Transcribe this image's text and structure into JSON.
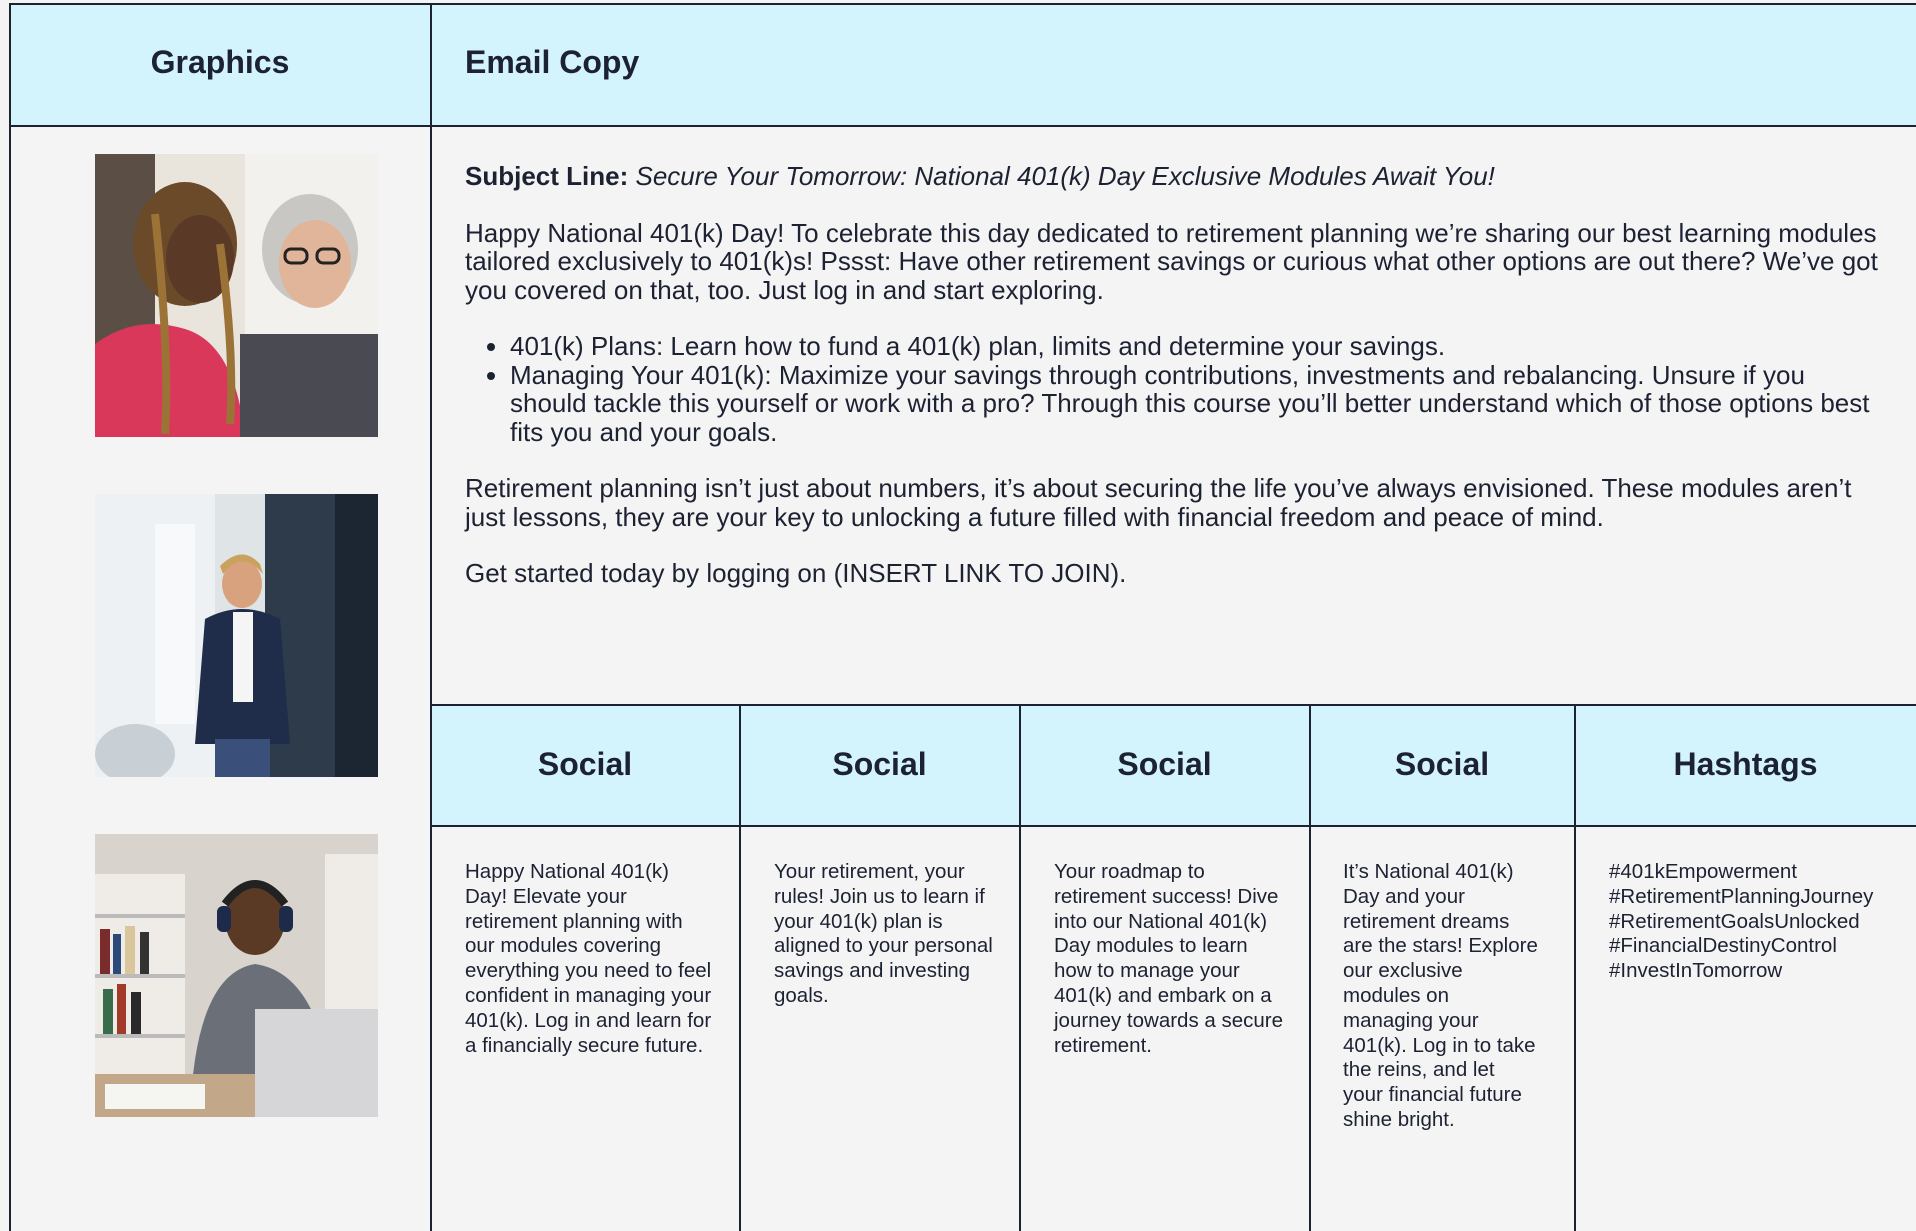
{
  "headers": {
    "graphics": "Graphics",
    "email_copy": "Email Copy"
  },
  "graphics": [
    {
      "name": "photo-two-women-laptop",
      "alt": "Two women looking at a laptop"
    },
    {
      "name": "photo-woman-presenting",
      "alt": "Smiling woman standing in an office"
    },
    {
      "name": "photo-man-headphones",
      "alt": "Man with headphones at a laptop"
    }
  ],
  "email": {
    "subject_label": "Subject Line:",
    "subject_text": "Secure Your Tomorrow: National 401(k) Day Exclusive Modules Await You!",
    "intro": "Happy National 401(k) Day!  To celebrate this day dedicated to retirement planning we’re sharing our best learning modules tailored exclusively to 401(k)s!  Pssst: Have other retirement savings or curious what other options are out there?  We’ve got you covered on that, too.  Just log in and start exploring.",
    "bullets": [
      "401(k) Plans: Learn how to fund a 401(k) plan, limits and determine your savings.",
      "Managing Your 401(k): Maximize your savings through contributions, investments and rebalancing.  Unsure if you should tackle this yourself or work with a pro? Through this course you’ll better understand which of those options best fits you and your goals."
    ],
    "body": "Retirement planning isn’t just about numbers, it’s about securing the life you’ve always envisioned. These modules aren’t just lessons, they are your key to unlocking a future filled with financial freedom and peace of mind.",
    "cta": "Get started today by logging on (INSERT LINK TO JOIN)."
  },
  "social": {
    "headers": [
      "Social",
      "Social",
      "Social",
      "Social",
      "Hashtags"
    ],
    "posts": [
      "Happy National 401(k) Day! Elevate your retirement planning with our modules covering everything you need to feel confident in managing your 401(k). Log in and learn for a financially secure future.",
      "Your retirement, your rules! Join us to learn if your 401(k) plan is aligned to your personal savings and investing goals.",
      "Your roadmap to retirement success! Dive into our National 401(k) Day modules to learn how to manage your 401(k) and embark on a journey towards a secure retirement.",
      "It’s National 401(k) Day and your retirement dreams are the stars! Explore our exclusive modules on managing your 401(k). Log in to take the reins, and let your financial future shine bright."
    ],
    "hashtags": [
      "#401kEmpowerment",
      "#RetirementPlanningJourney",
      "#RetirementGoalsUnlocked",
      "#FinancialDestinyControl",
      "#InvestInTomorrow"
    ]
  },
  "colors": {
    "header_bg": "#d4f4fd",
    "page_bg": "#f4f4f4",
    "border": "#1d2233",
    "text": "#1d2233"
  }
}
